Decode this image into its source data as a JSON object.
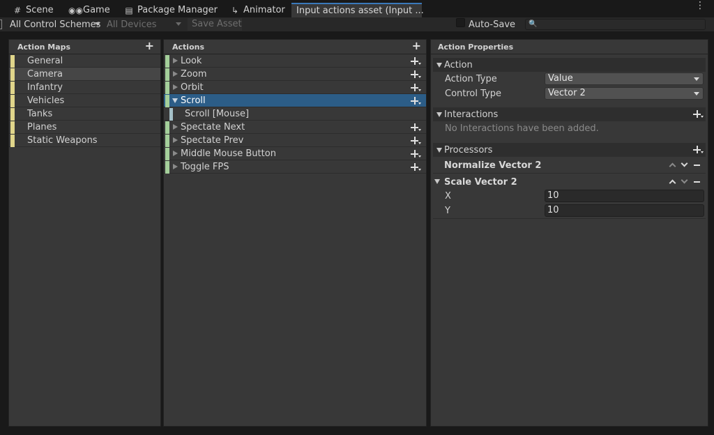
{
  "tabs": [
    {
      "label": "Scene",
      "icon": "grid-icon"
    },
    {
      "label": "Game",
      "icon": "gamepad-icon"
    },
    {
      "label": "Package Manager",
      "icon": "package-icon"
    },
    {
      "label": "Animator",
      "icon": "animator-icon"
    },
    {
      "label": "Input actions asset (Input ...",
      "icon": ""
    }
  ],
  "toolbar": {
    "control_schemes": "All Control Schemes",
    "devices": "All Devices",
    "save_asset": "Save Asset",
    "auto_save": "Auto-Save",
    "search_placeholder": ""
  },
  "action_maps": {
    "title": "Action Maps",
    "items": [
      "General",
      "Camera",
      "Infantry",
      "Vehicles",
      "Tanks",
      "Planes",
      "Static Weapons"
    ],
    "selected": "Camera"
  },
  "actions": {
    "title": "Actions",
    "items": [
      {
        "label": "Look"
      },
      {
        "label": "Zoom"
      },
      {
        "label": "Orbit"
      },
      {
        "label": "Scroll",
        "expanded": true,
        "selected": true
      },
      {
        "label": "Scroll [Mouse]",
        "binding": true
      },
      {
        "label": "Spectate Next"
      },
      {
        "label": "Spectate Prev"
      },
      {
        "label": "Middle Mouse Button"
      },
      {
        "label": "Toggle FPS"
      }
    ]
  },
  "properties": {
    "title": "Action Properties",
    "action_section": "Action",
    "action_type_label": "Action Type",
    "action_type_value": "Value",
    "control_type_label": "Control Type",
    "control_type_value": "Vector 2",
    "interactions_section": "Interactions",
    "interactions_empty": "No Interactions have been added.",
    "processors_section": "Processors",
    "processor1": "Normalize Vector 2",
    "processor2": "Scale Vector 2",
    "x_label": "X",
    "x_value": "10",
    "y_label": "Y",
    "y_value": "10"
  },
  "colors": {
    "accent": "#3a79bb",
    "selection": "#2c5d87",
    "map_stripe": "#e0d58a",
    "action_stripe": "#a4cf9a"
  }
}
